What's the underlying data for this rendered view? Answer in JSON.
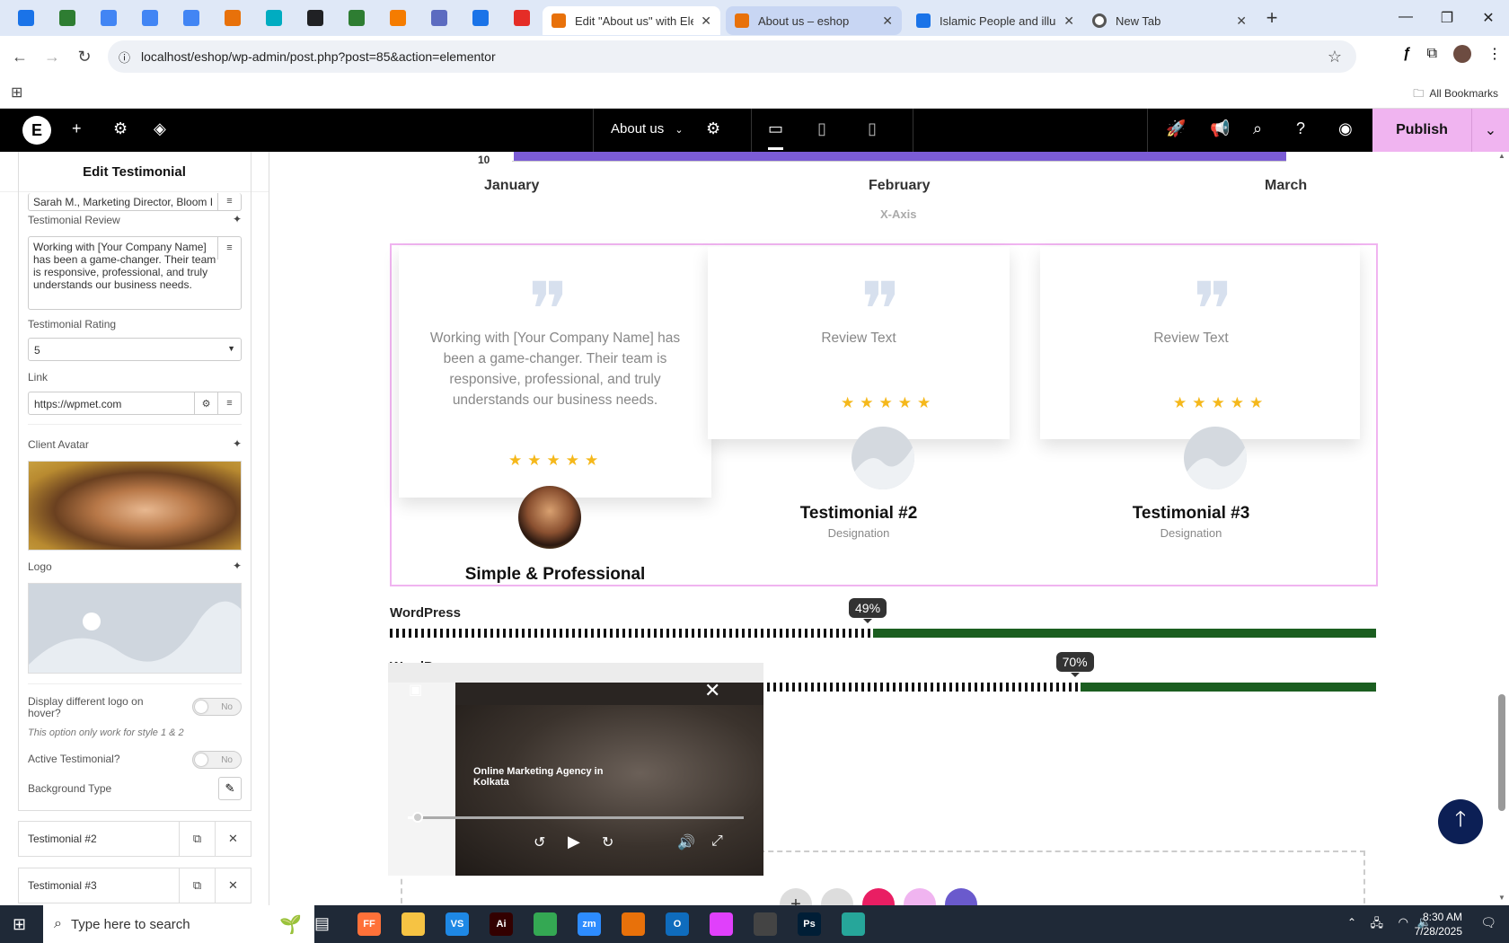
{
  "browser": {
    "pinned_tab_colors": [
      "#1a73e8",
      "#2e7d32",
      "#4285f4",
      "#4285f4",
      "#4285f4",
      "#e8710a",
      "#00acc1",
      "#202124",
      "#2e7d32",
      "#f57c00",
      "#5c6bc0",
      "#1a73e8",
      "#e52d27"
    ],
    "tabs": [
      {
        "title": "Edit \"About us\" with Elem",
        "icon_color": "#e8710a",
        "state": "active"
      },
      {
        "title": "About us – eshop",
        "icon_color": "#e8710a",
        "state": "highlighted"
      },
      {
        "title": "Islamic People and illustr",
        "icon_color": "#1a73e8",
        "state": "normal"
      },
      {
        "title": "New Tab",
        "icon_color": "#555555",
        "state": "normal"
      }
    ],
    "url": "localhost/eshop/wp-admin/post.php?post=85&action=elementor",
    "bookmarks_label": "All Bookmarks"
  },
  "editor": {
    "page_selector": "About us",
    "publish_label": "Publish",
    "accent": "#f0b4f0"
  },
  "panel": {
    "title": "Edit Testimonial",
    "client_designation_value": "Sarah M., Marketing Director, Bloom I",
    "review_label": "Testimonial Review",
    "review_value": "Working with [Your Company Name] has been a game-changer. Their team is responsive, professional, and truly understands our business needs.",
    "rating_label": "Testimonial Rating",
    "rating_value": "5",
    "link_label": "Link",
    "link_value": "https://wpmet.com",
    "avatar_label": "Client Avatar",
    "logo_label": "Logo",
    "hover_logo_label": "Display different logo on hover?",
    "hover_logo_value": "No",
    "hint": "This option only work for style 1 & 2",
    "active_label": "Active Testimonial?",
    "active_value": "No",
    "background_label": "Background Type",
    "repeaters": [
      "Testimonial #2",
      "Testimonial #3"
    ]
  },
  "chart_fragment": {
    "y_tick": "10",
    "months": [
      "January",
      "February",
      "March"
    ],
    "x_axis_title": "X-Axis",
    "bar_color": "#7b5cd6"
  },
  "testimonials": [
    {
      "review": "Working with [Your Company Name] has been a game-changer. Their team is responsive, professional, and truly understands our business needs.",
      "stars": "★★★★★",
      "name": "Simple & Professional",
      "designation": ""
    },
    {
      "review": "Review Text",
      "stars": "★★★★★",
      "name": "Testimonial #2",
      "designation": "Designation"
    },
    {
      "review": "Review Text",
      "stars": "★★★★★",
      "name": "Testimonial #3",
      "designation": "Designation"
    }
  ],
  "skills": [
    {
      "label": "WordPress",
      "percent": 49,
      "percent_label": "49%"
    },
    {
      "label": "WordP",
      "percent": 70,
      "percent_label": "70%"
    }
  ],
  "video": {
    "caption": "Online Marketing Agency in Kolkata",
    "progress": 0.03
  },
  "taskbar": {
    "search_placeholder": "Type here to search",
    "time": "8:30 AM",
    "date": "7/28/2025",
    "apps": [
      {
        "label": "FF",
        "color": "#ff7139"
      },
      {
        "label": "",
        "color": "#f6c343"
      },
      {
        "label": "VS",
        "color": "#1e88e5"
      },
      {
        "label": "Ai",
        "color": "#330000"
      },
      {
        "label": "",
        "color": "#34a853"
      },
      {
        "label": "zm",
        "color": "#2d8cff"
      },
      {
        "label": "",
        "color": "#e8710a"
      },
      {
        "label": "O",
        "color": "#0f6cbd"
      },
      {
        "label": "",
        "color": "#e040fb"
      },
      {
        "label": "",
        "color": "#444444"
      },
      {
        "label": "Ps",
        "color": "#001e36"
      },
      {
        "label": "",
        "color": "#26a69a"
      }
    ]
  }
}
